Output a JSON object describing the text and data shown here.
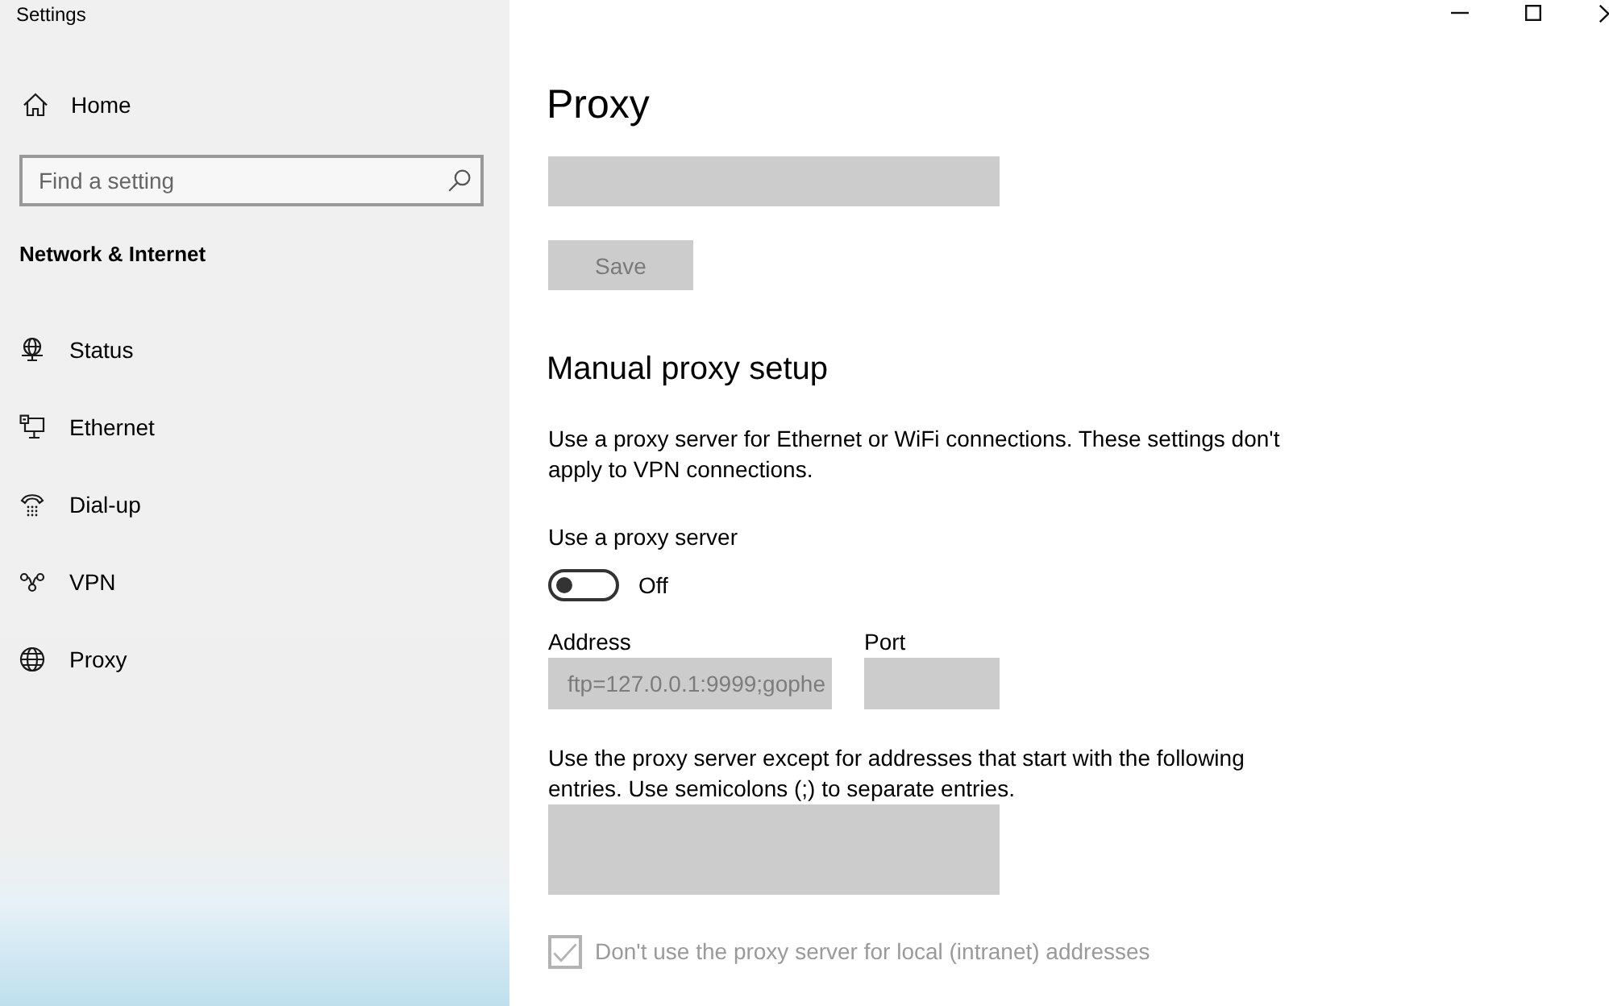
{
  "window": {
    "title": "Settings"
  },
  "sidebar": {
    "home": {
      "label": "Home"
    },
    "search": {
      "placeholder": "Find a setting"
    },
    "section_title": "Network & Internet",
    "items": [
      {
        "label": "Status",
        "kind": "status"
      },
      {
        "label": "Ethernet",
        "kind": "ethernet"
      },
      {
        "label": "Dial-up",
        "kind": "dialup"
      },
      {
        "label": "VPN",
        "kind": "vpn"
      },
      {
        "label": "Proxy",
        "kind": "proxy"
      }
    ]
  },
  "page": {
    "title": "Proxy",
    "top_field": {
      "disabled": true
    },
    "save_button": {
      "label": "Save",
      "disabled": true
    },
    "manual_setup": {
      "heading": "Manual proxy setup",
      "description": "Use a proxy server for Ethernet or WiFi connections. These settings don't apply to VPN connections.",
      "use_proxy": {
        "label": "Use a proxy server",
        "on": false,
        "state_text": "Off"
      },
      "address": {
        "label": "Address",
        "value": "ftp=127.0.0.1:9999;gophe",
        "disabled": true
      },
      "port": {
        "label": "Port",
        "disabled": true
      },
      "exceptions": {
        "description": "Use the proxy server except for addresses that start with the following entries. Use semicolons (;) to separate entries.",
        "disabled": true
      },
      "bypass_local": {
        "label": "Don't use the proxy server for local (intranet) addresses",
        "checked": true,
        "disabled": true
      }
    }
  }
}
